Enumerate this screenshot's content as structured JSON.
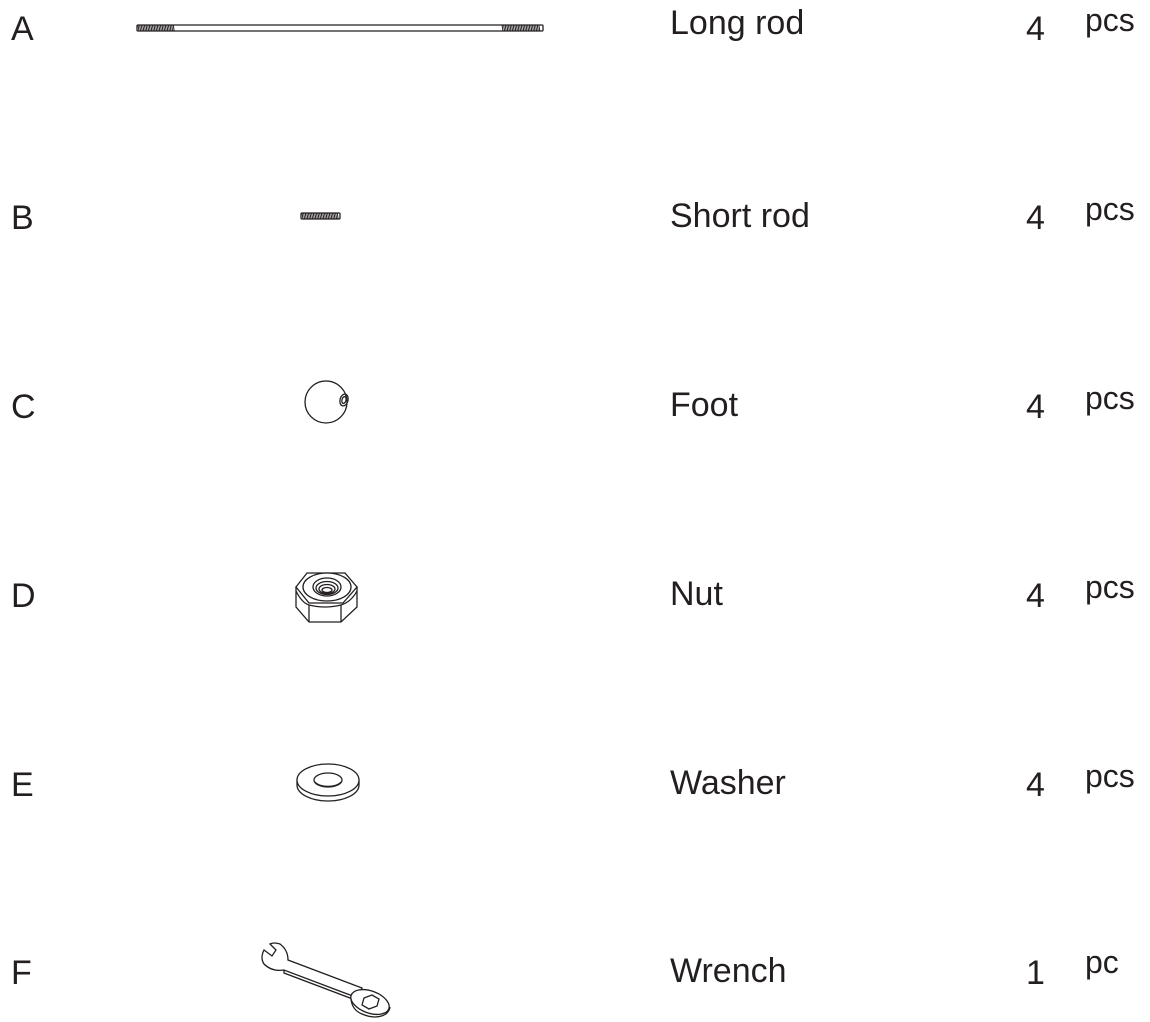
{
  "parts": [
    {
      "letter": "A",
      "name": "Long rod",
      "qty": "4",
      "unit": "pcs",
      "icon": "long-rod-icon"
    },
    {
      "letter": "B",
      "name": "Short rod",
      "qty": "4",
      "unit": "pcs",
      "icon": "short-rod-icon"
    },
    {
      "letter": "C",
      "name": "Foot",
      "qty": "4",
      "unit": "pcs",
      "icon": "foot-ball-icon"
    },
    {
      "letter": "D",
      "name": "Nut",
      "qty": "4",
      "unit": "pcs",
      "icon": "hex-nut-icon"
    },
    {
      "letter": "E",
      "name": "Washer",
      "qty": "4",
      "unit": "pcs",
      "icon": "washer-icon"
    },
    {
      "letter": "F",
      "name": "Wrench",
      "qty": "1",
      "unit": "pc",
      "icon": "wrench-icon"
    }
  ]
}
